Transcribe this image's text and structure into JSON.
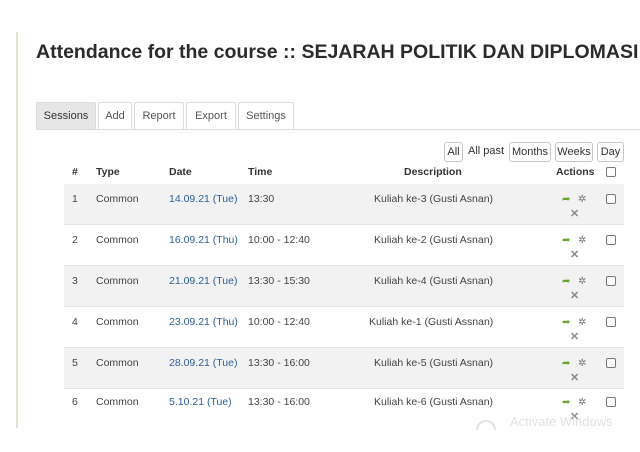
{
  "title": "Attendance for the course :: SEJARAH POLITIK DAN DIPLOMASI MINANGKABAU (B)",
  "tabs": [
    {
      "label": "Sessions",
      "active": true
    },
    {
      "label": "Add"
    },
    {
      "label": "Report"
    },
    {
      "label": "Export"
    },
    {
      "label": "Settings"
    }
  ],
  "filters": {
    "all": "All",
    "all_past": "All past",
    "months": "Months",
    "weeks": "Weeks",
    "day": "Day"
  },
  "columns": {
    "num": "#",
    "type": "Type",
    "date": "Date",
    "time": "Time",
    "description": "Description",
    "actions": "Actions"
  },
  "sessions": [
    {
      "num": "1",
      "type": "Common",
      "date": "14.09.21 (Tue)",
      "time": "13:30",
      "description": "Kuliah ke-3 (Gusti Asnan)"
    },
    {
      "num": "2",
      "type": "Common",
      "date": "16.09.21 (Thu)",
      "time": "10:00 - 12:40",
      "description": "Kuliah ke-2 (Gusti Asnan)"
    },
    {
      "num": "3",
      "type": "Common",
      "date": "21.09.21 (Tue)",
      "time": "13:30 - 15:30",
      "description": "Kuliah ke-4 (Gusti Asnan)"
    },
    {
      "num": "4",
      "type": "Common",
      "date": "23.09.21 (Thu)",
      "time": "10:00 - 12:40",
      "description": "Kuliah ke-1 (Gusti Assnan)"
    },
    {
      "num": "5",
      "type": "Common",
      "date": "28.09.21 (Tue)",
      "time": "13:30 - 16:00",
      "description": "Kuliah ke-5 (Gusti Asnan)"
    },
    {
      "num": "6",
      "type": "Common",
      "date": "5.10.21 (Tue)",
      "time": "13:30 - 16:00",
      "description": "Kuliah ke-6 (Gusti Asnan)"
    }
  ],
  "icons": {
    "go": "arrow-right-icon",
    "settings": "gear-icon",
    "delete": "close-icon"
  },
  "watermark": "Activate Windows",
  "colors": {
    "date_link": "#2d5f9a",
    "go_icon": "#6aa42e",
    "active_tab": "#e6e6e6"
  }
}
